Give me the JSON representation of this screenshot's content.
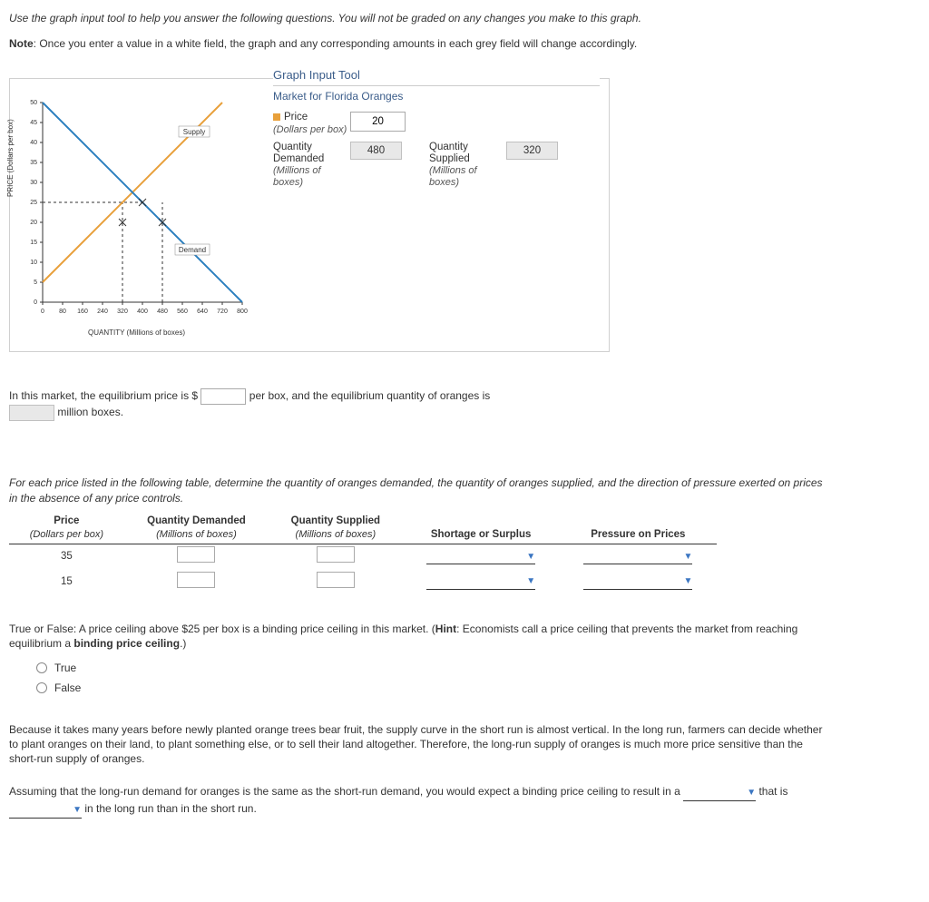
{
  "intro": {
    "line1": "Use the graph input tool to help you answer the following questions. You will not be graded on any changes you make to this graph.",
    "note_label": "Note",
    "note_body": ": Once you enter a value in a white field, the graph and any corresponding amounts in each grey field will change accordingly."
  },
  "tool": {
    "title": "Graph Input Tool",
    "subtitle": "Market for Florida Oranges",
    "price_label": "Price",
    "price_sub": "(Dollars per box)",
    "price_value": "20",
    "qd_label": "Quantity Demanded",
    "qd_sub": "(Millions of boxes)",
    "qd_value": "480",
    "qs_label": "Quantity Supplied",
    "qs_sub": "(Millions of boxes)",
    "qs_value": "320"
  },
  "chart_data": {
    "type": "line",
    "title": "",
    "xlabel": "QUANTITY (Millions of boxes)",
    "ylabel": "PRICE (Dollars per box)",
    "xlim": [
      0,
      800
    ],
    "ylim": [
      0,
      50
    ],
    "x_ticks": [
      0,
      80,
      160,
      240,
      320,
      400,
      480,
      560,
      640,
      720,
      800
    ],
    "y_ticks": [
      0,
      5,
      10,
      15,
      20,
      25,
      30,
      35,
      40,
      45,
      50
    ],
    "series": [
      {
        "name": "Supply",
        "color": "#e8a03b",
        "points": [
          [
            0,
            5
          ],
          [
            720,
            50
          ]
        ]
      },
      {
        "name": "Demand",
        "color": "#2b7fbf",
        "points": [
          [
            0,
            50
          ],
          [
            800,
            0
          ]
        ]
      }
    ],
    "markers": {
      "price": 25,
      "qd": 480,
      "qs": 320,
      "current_price_line": 20
    },
    "legend": {
      "Supply": [
        636,
        42
      ],
      "Demand": [
        592,
        12
      ]
    }
  },
  "q1": {
    "pre": "In this market, the equilibrium price is $",
    "mid": "per box, and the equilibrium quantity of oranges is",
    "tail": "million boxes."
  },
  "q2": {
    "prompt": "For each price listed in the following table, determine the quantity of oranges demanded, the quantity of oranges supplied, and the direction of pressure exerted on prices in the absence of any price controls.",
    "headers": {
      "price": "Price",
      "price_sub": "(Dollars per box)",
      "qd": "Quantity Demanded",
      "qd_sub": "(Millions of boxes)",
      "qs": "Quantity Supplied",
      "qs_sub": "(Millions of boxes)",
      "ss": "Shortage or Surplus",
      "pp": "Pressure on Prices"
    },
    "rows": [
      {
        "price": "35"
      },
      {
        "price": "15"
      }
    ]
  },
  "q3": {
    "text_a": "True or False: A price ceiling above $25 per box is a binding price ceiling in this market. (",
    "hint_label": "Hint",
    "text_b": ": Economists call a price ceiling that prevents the market from reaching equilibrium a ",
    "bold_term": "binding price ceiling",
    "text_c": ".)",
    "opt_true": "True",
    "opt_false": "False"
  },
  "q4": {
    "para": "Because it takes many years before newly planted orange trees bear fruit, the supply curve in the short run is almost vertical. In the long run, farmers can decide whether to plant oranges on their land, to plant something else, or to sell their land altogether. Therefore, the long-run supply of oranges is much more price sensitive than the short-run supply of oranges.",
    "line_a": "Assuming that the long-run demand for oranges is the same as the short-run demand, you would expect a binding price ceiling to result in a ",
    "line_b": " that is ",
    "line_c": " in the long run than in the short run."
  }
}
